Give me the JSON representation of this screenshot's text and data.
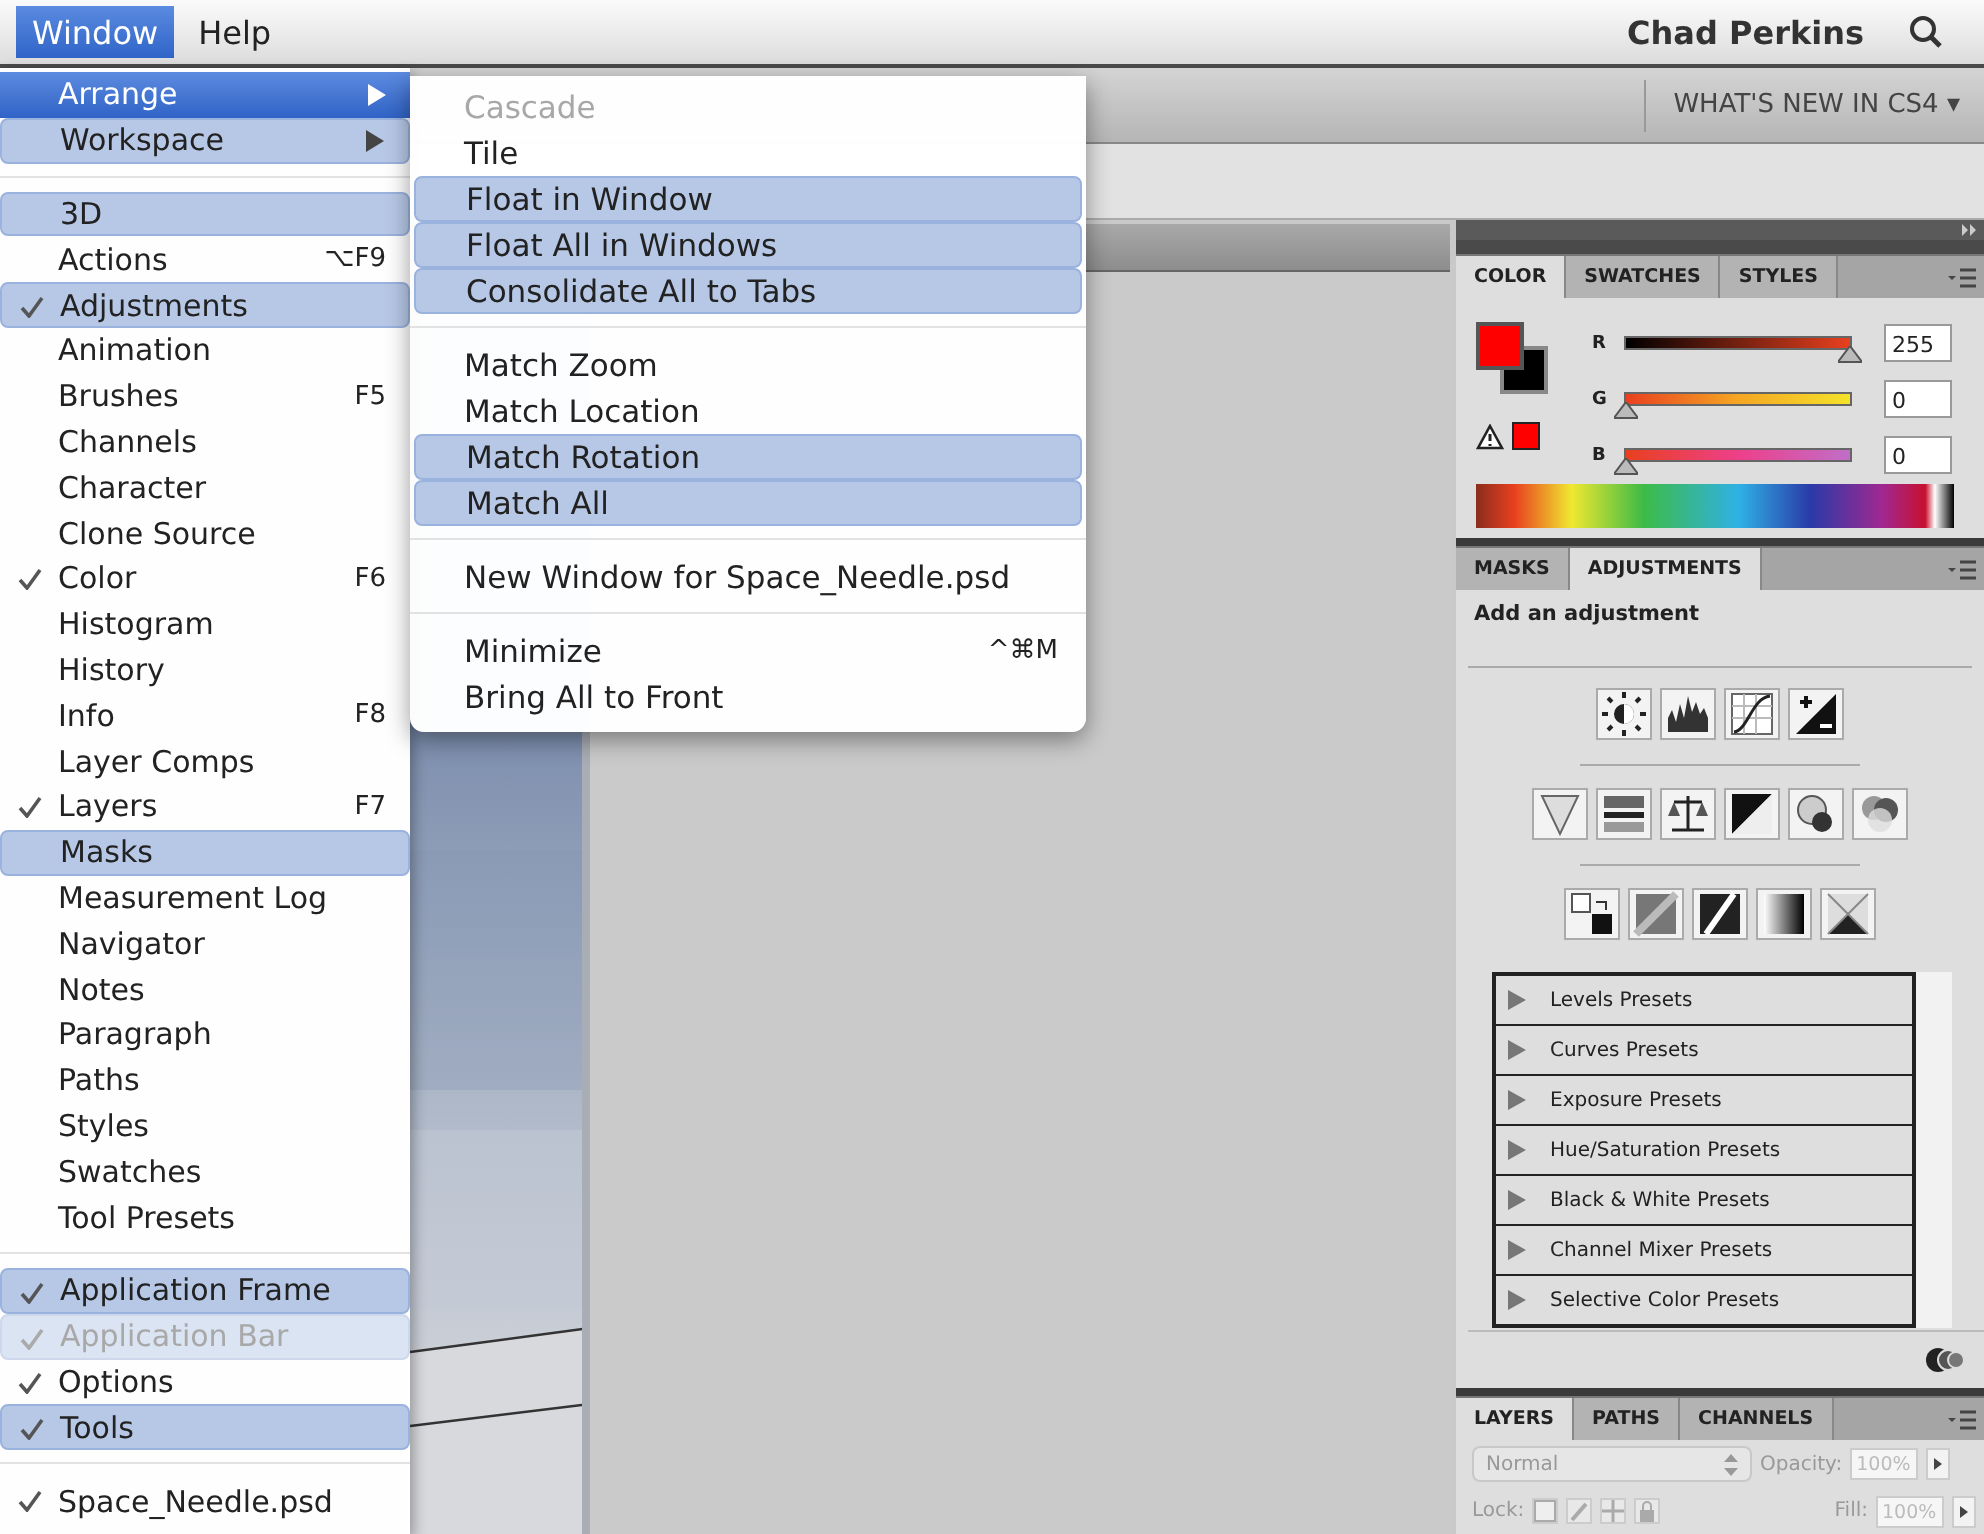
{
  "menu_bar": {
    "items": [
      {
        "label": "Window",
        "selected": true
      },
      {
        "label": "Help",
        "selected": false
      }
    ],
    "user": "Chad Perkins"
  },
  "app_bar": {
    "workspace": "WHAT'S NEW IN CS4 ▾"
  },
  "window_menu": {
    "items": [
      {
        "kind": "item",
        "label": "Arrange",
        "submenu": true,
        "selected": true,
        "highlighted": false,
        "checked": false,
        "disabled": false
      },
      {
        "kind": "item",
        "label": "Workspace",
        "submenu": true,
        "selected": false,
        "highlighted": true,
        "checked": false,
        "disabled": false
      },
      {
        "kind": "separator"
      },
      {
        "kind": "item",
        "label": "3D",
        "submenu": false,
        "selected": false,
        "highlighted": true,
        "checked": false,
        "disabled": false
      },
      {
        "kind": "item",
        "label": "Actions",
        "shortcut": "⌥F9",
        "submenu": false,
        "selected": false,
        "highlighted": false,
        "checked": false,
        "disabled": false
      },
      {
        "kind": "item",
        "label": "Adjustments",
        "submenu": false,
        "selected": false,
        "highlighted": true,
        "checked": true,
        "disabled": false
      },
      {
        "kind": "item",
        "label": "Animation",
        "submenu": false,
        "selected": false,
        "highlighted": false,
        "checked": false,
        "disabled": false
      },
      {
        "kind": "item",
        "label": "Brushes",
        "shortcut": "F5",
        "submenu": false,
        "selected": false,
        "highlighted": false,
        "checked": false,
        "disabled": false
      },
      {
        "kind": "item",
        "label": "Channels",
        "submenu": false,
        "selected": false,
        "highlighted": false,
        "checked": false,
        "disabled": false
      },
      {
        "kind": "item",
        "label": "Character",
        "submenu": false,
        "selected": false,
        "highlighted": false,
        "checked": false,
        "disabled": false
      },
      {
        "kind": "item",
        "label": "Clone Source",
        "submenu": false,
        "selected": false,
        "highlighted": false,
        "checked": false,
        "disabled": false
      },
      {
        "kind": "item",
        "label": "Color",
        "shortcut": "F6",
        "submenu": false,
        "selected": false,
        "highlighted": false,
        "checked": true,
        "disabled": false
      },
      {
        "kind": "item",
        "label": "Histogram",
        "submenu": false,
        "selected": false,
        "highlighted": false,
        "checked": false,
        "disabled": false
      },
      {
        "kind": "item",
        "label": "History",
        "submenu": false,
        "selected": false,
        "highlighted": false,
        "checked": false,
        "disabled": false
      },
      {
        "kind": "item",
        "label": "Info",
        "shortcut": "F8",
        "submenu": false,
        "selected": false,
        "highlighted": false,
        "checked": false,
        "disabled": false
      },
      {
        "kind": "item",
        "label": "Layer Comps",
        "submenu": false,
        "selected": false,
        "highlighted": false,
        "checked": false,
        "disabled": false
      },
      {
        "kind": "item",
        "label": "Layers",
        "shortcut": "F7",
        "submenu": false,
        "selected": false,
        "highlighted": false,
        "checked": true,
        "disabled": false
      },
      {
        "kind": "item",
        "label": "Masks",
        "submenu": false,
        "selected": false,
        "highlighted": true,
        "checked": false,
        "disabled": false
      },
      {
        "kind": "item",
        "label": "Measurement Log",
        "submenu": false,
        "selected": false,
        "highlighted": false,
        "checked": false,
        "disabled": false
      },
      {
        "kind": "item",
        "label": "Navigator",
        "submenu": false,
        "selected": false,
        "highlighted": false,
        "checked": false,
        "disabled": false
      },
      {
        "kind": "item",
        "label": "Notes",
        "submenu": false,
        "selected": false,
        "highlighted": false,
        "checked": false,
        "disabled": false
      },
      {
        "kind": "item",
        "label": "Paragraph",
        "submenu": false,
        "selected": false,
        "highlighted": false,
        "checked": false,
        "disabled": false
      },
      {
        "kind": "item",
        "label": "Paths",
        "submenu": false,
        "selected": false,
        "highlighted": false,
        "checked": false,
        "disabled": false
      },
      {
        "kind": "item",
        "label": "Styles",
        "submenu": false,
        "selected": false,
        "highlighted": false,
        "checked": false,
        "disabled": false
      },
      {
        "kind": "item",
        "label": "Swatches",
        "submenu": false,
        "selected": false,
        "highlighted": false,
        "checked": false,
        "disabled": false
      },
      {
        "kind": "item",
        "label": "Tool Presets",
        "submenu": false,
        "selected": false,
        "highlighted": false,
        "checked": false,
        "disabled": false
      },
      {
        "kind": "separator"
      },
      {
        "kind": "item",
        "label": "Application Frame",
        "submenu": false,
        "selected": false,
        "highlighted": true,
        "checked": true,
        "disabled": false
      },
      {
        "kind": "item",
        "label": "Application Bar",
        "submenu": false,
        "selected": false,
        "highlighted": true,
        "checked": true,
        "disabled": true
      },
      {
        "kind": "item",
        "label": "Options",
        "submenu": false,
        "selected": false,
        "highlighted": false,
        "checked": true,
        "disabled": false
      },
      {
        "kind": "item",
        "label": "Tools",
        "submenu": false,
        "selected": false,
        "highlighted": true,
        "checked": true,
        "disabled": false
      },
      {
        "kind": "separator"
      },
      {
        "kind": "item",
        "label": "Space_Needle.psd",
        "submenu": false,
        "selected": false,
        "highlighted": false,
        "checked": true,
        "disabled": false
      }
    ]
  },
  "arrange_submenu": {
    "items": [
      {
        "kind": "item",
        "label": "Cascade",
        "highlighted": false,
        "disabled": true
      },
      {
        "kind": "item",
        "label": "Tile",
        "highlighted": false,
        "disabled": false
      },
      {
        "kind": "item",
        "label": "Float in Window",
        "highlighted": true,
        "disabled": false
      },
      {
        "kind": "item",
        "label": "Float All in Windows",
        "highlighted": true,
        "disabled": false
      },
      {
        "kind": "item",
        "label": "Consolidate All to Tabs",
        "highlighted": true,
        "disabled": false
      },
      {
        "kind": "separator"
      },
      {
        "kind": "item",
        "label": "Match Zoom",
        "highlighted": false,
        "disabled": false
      },
      {
        "kind": "item",
        "label": "Match Location",
        "highlighted": false,
        "disabled": false
      },
      {
        "kind": "item",
        "label": "Match Rotation",
        "highlighted": true,
        "disabled": false
      },
      {
        "kind": "item",
        "label": "Match All",
        "highlighted": true,
        "disabled": false
      },
      {
        "kind": "separator"
      },
      {
        "kind": "item",
        "label": "New Window for Space_Needle.psd",
        "highlighted": false,
        "disabled": false
      },
      {
        "kind": "separator"
      },
      {
        "kind": "item",
        "label": "Minimize",
        "shortcut": "^⌘M",
        "highlighted": false,
        "disabled": false
      },
      {
        "kind": "item",
        "label": "Bring All to Front",
        "highlighted": false,
        "disabled": false
      }
    ]
  },
  "color_panel": {
    "tabs": [
      {
        "label": "COLOR",
        "selected": true
      },
      {
        "label": "SWATCHES",
        "selected": false
      },
      {
        "label": "STYLES",
        "selected": false
      }
    ],
    "channels": [
      {
        "label": "R",
        "value": "255",
        "level": 1
      },
      {
        "label": "G",
        "value": "0",
        "level": 0
      },
      {
        "label": "B",
        "value": "0",
        "level": 0
      }
    ]
  },
  "adjustments_panel": {
    "tabs": [
      {
        "label": "MASKS",
        "selected": false
      },
      {
        "label": "ADJUSTMENTS",
        "selected": true
      }
    ],
    "heading": "Add an adjustment",
    "presets": [
      {
        "label": "Levels Presets",
        "expanded": false
      },
      {
        "label": "Curves Presets",
        "expanded": false
      },
      {
        "label": "Exposure Presets",
        "expanded": false
      },
      {
        "label": "Hue/Saturation Presets",
        "expanded": false
      },
      {
        "label": "Black & White Presets",
        "expanded": false
      },
      {
        "label": "Channel Mixer Presets",
        "expanded": false
      },
      {
        "label": "Selective Color Presets",
        "expanded": false
      }
    ]
  },
  "layers_panel": {
    "tabs": [
      {
        "label": "LAYERS",
        "selected": true
      },
      {
        "label": "PATHS",
        "selected": false
      },
      {
        "label": "CHANNELS",
        "selected": false
      }
    ],
    "blend_mode": "Normal",
    "opacity_label": "Opacity:",
    "opacity": "100%",
    "lock_label": "Lock:",
    "fill_label": "Fill:",
    "fill": "100%"
  }
}
